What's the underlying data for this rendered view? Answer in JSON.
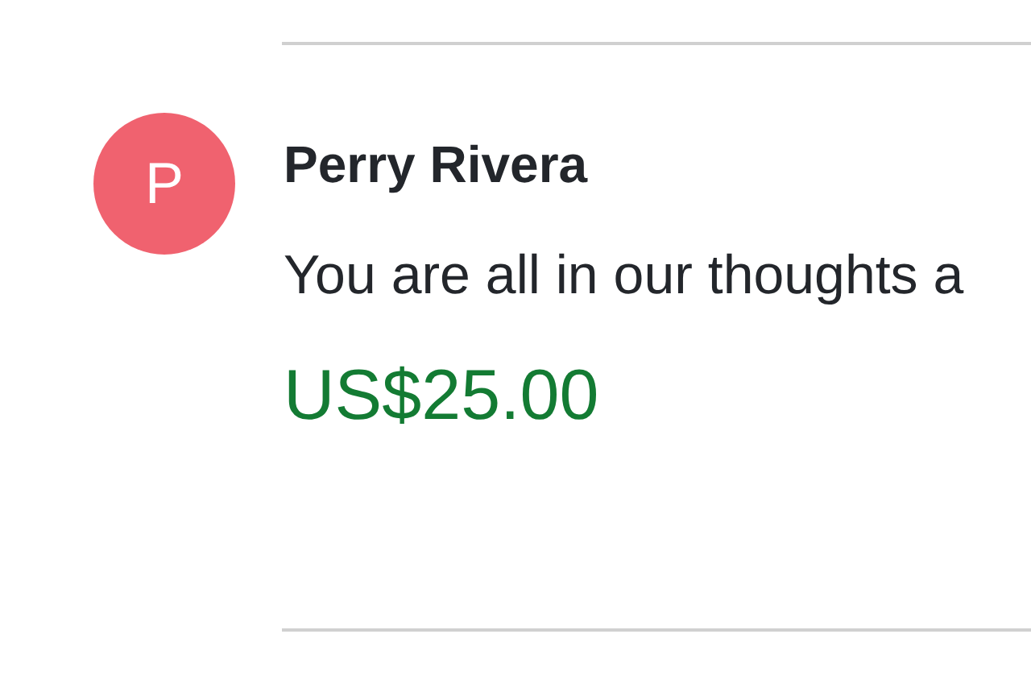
{
  "donation": {
    "avatar": {
      "initial": "P",
      "color": "#f0626f"
    },
    "name": "Perry Rivera",
    "message": "You are all in our thoughts a",
    "amount": "US$25.00"
  }
}
